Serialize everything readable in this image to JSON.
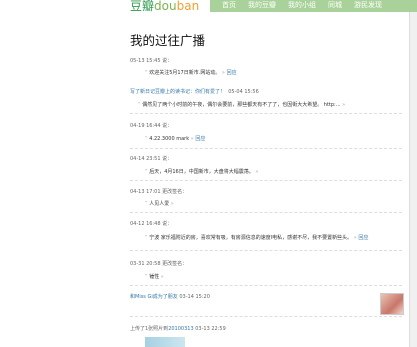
{
  "header": {
    "logo_dou": "豆瓣",
    "logo_rest": "dou",
    "logo_ban": "ban",
    "nav": [
      "首页",
      "我的豆瓣",
      "我的小组",
      "同城",
      "游民发现"
    ]
  },
  "page_title": "我的过往广播",
  "feed": [
    {
      "meta": "05-13 15:45 说：",
      "text": "欢迎关注5月17日新市.网站动。",
      "reply": "回应"
    },
    {
      "meta": "写了新日记",
      "link": "豆瓣上的读书记：你们有爱了！",
      "time": "05-04 15:56"
    },
    {
      "meta": "",
      "text": "偶然见了两个小时前的午夜，偶尔会要前，那些都天有不了了，也因街大大希望。   http:...",
      "reply": ""
    },
    {
      "meta": "04-19 16:44 说：",
      "text": "4.22.3000 mark",
      "reply": "回应"
    },
    {
      "meta": "04-14 23:51 说：",
      "text": "后天，4月16日，中国新市，大盘将大幅震荡。",
      "reply": ""
    },
    {
      "meta": "04-13 17:01 更改签名：",
      "text": "人见人爱",
      "reply": ""
    },
    {
      "meta": "04-12 16:48 说：",
      "text": "宁波 家乐福附近的房，喜欢常有吸，有房源信息的速度l电私，感谢不尽，我不要置新些头。",
      "reply": "回应"
    },
    {
      "meta": "03-31 20:58 更改签名：",
      "text": "锤性",
      "reply": ""
    },
    {
      "meta": "和Miss Gi成为了朋友",
      "time": "03-14 15:20"
    },
    {
      "meta": "上传了1张照片到",
      "link": "20100313",
      "time": "03-13 22:59"
    }
  ]
}
